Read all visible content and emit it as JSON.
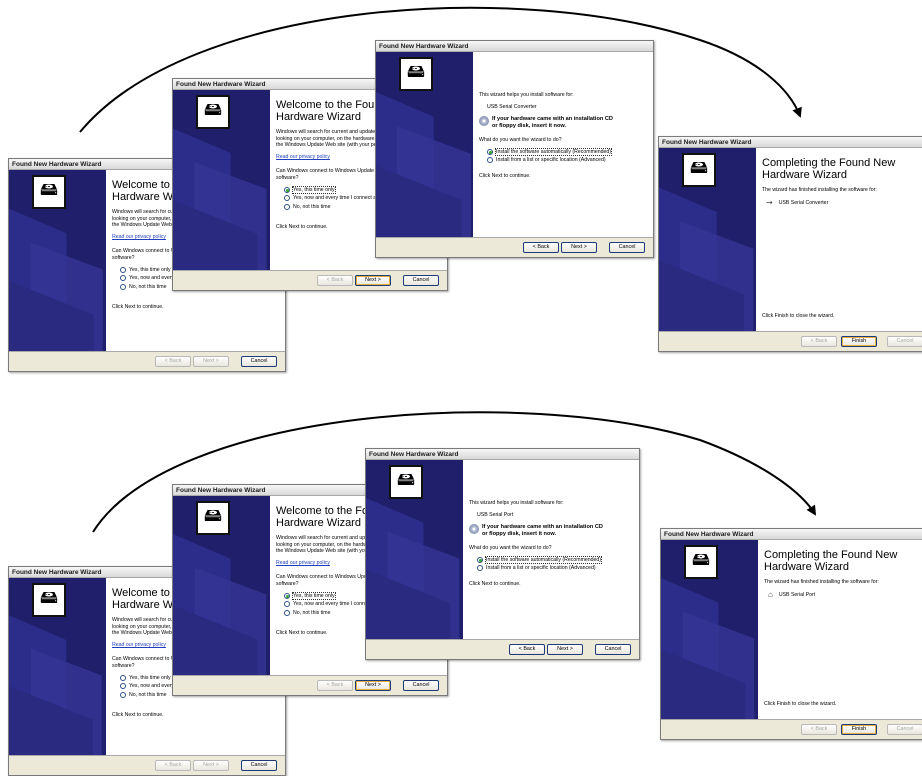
{
  "window_title": "Found New Hardware Wizard",
  "welcome": {
    "title": "Welcome to the Found New Hardware Wizard",
    "title_line1": "Welcome to the Found New",
    "title_line2": "Hardware Wizard",
    "intro_line1": "Windows will search for current and updated software by",
    "intro_line2": "looking on your computer, on the hardware installation CD, or on",
    "intro_line3": "the Windows Update Web site (with your permission).",
    "privacy_link": "Read our privacy policy",
    "question_line1": "Can Windows connect to Windows Update to search for",
    "question_line2": "software?",
    "options": [
      "Yes, this time only",
      "Yes, now and every time I connect a device",
      "No, not this time"
    ],
    "continue": "Click Next to continue."
  },
  "install": {
    "helps": "This wizard helps you install software for:",
    "cd_line1": "If your hardware came with an installation CD",
    "cd_line2": "or floppy disk, insert it now.",
    "question": "What do you want the wizard to do?",
    "options": [
      "Install the software automatically (Recommended)",
      "Install from a list or specific location (Advanced)"
    ],
    "continue": "Click Next to continue."
  },
  "complete": {
    "title_line1": "Completing the Found New",
    "title_line2": "Hardware Wizard",
    "finished": "The wizard has finished installing the software for:",
    "close_text": "Click Finish to close the wizard."
  },
  "buttons": {
    "back": "< Back",
    "next": "Next >",
    "cancel": "Cancel",
    "finish": "Finish"
  },
  "rows": [
    {
      "device": "USB Serial Converter",
      "device_icon": "usb-plug-icon"
    },
    {
      "device": "USB Serial Port",
      "device_icon": "serial-port-icon"
    }
  ],
  "colors": {
    "sidebar": "#1f1f6b",
    "dialog_face": "#ece9d8",
    "link": "#1f3dbf",
    "arrow": "#000000"
  }
}
